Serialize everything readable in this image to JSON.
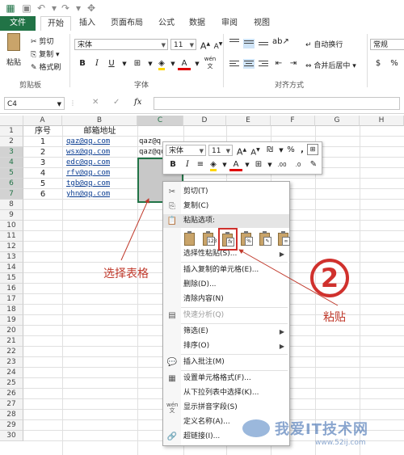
{
  "tabs": [
    "文件",
    "开始",
    "插入",
    "页面布局",
    "公式",
    "数据",
    "审阅",
    "视图"
  ],
  "clipboard": {
    "paste": "粘贴",
    "cut": "剪切",
    "copy": "复制",
    "format_painter": "格式刷",
    "label": "剪贴板"
  },
  "font": {
    "name": "宋体",
    "size": "11",
    "bold": "B",
    "italic": "I",
    "underline": "U",
    "grow": "A",
    "shrink": "A",
    "color_a": "A",
    "wen": "wén",
    "label": "字体"
  },
  "alignment": {
    "wrap": "自动换行",
    "merge": "合并后居中",
    "label": "对齐方式"
  },
  "number": {
    "format": "常规"
  },
  "formula_bar": {
    "cell_ref": "C4",
    "fx": "fx"
  },
  "columns": [
    "A",
    "B",
    "C",
    "D",
    "E",
    "F",
    "G",
    "H"
  ],
  "rows": [
    "1",
    "2",
    "3",
    "4",
    "5",
    "6",
    "7",
    "8",
    "9",
    "10",
    "11",
    "12",
    "13",
    "14",
    "15",
    "16",
    "17",
    "18",
    "19",
    "20",
    "21",
    "22",
    "23",
    "24",
    "25",
    "26",
    "27",
    "28",
    "29",
    "30"
  ],
  "table": {
    "header": [
      "序号",
      "邮箱地址"
    ],
    "rows": [
      [
        "1",
        "qaz@qq.com",
        "qaz@q"
      ],
      [
        "2",
        "wsx@qq.com",
        "qaz@qq"
      ],
      [
        "3",
        "edc@qq.com",
        ""
      ],
      [
        "4",
        "rfv@qq.com",
        ""
      ],
      [
        "5",
        "tgb@qq.com",
        ""
      ],
      [
        "6",
        "yhn@qq.com",
        ""
      ]
    ]
  },
  "mini_toolbar": {
    "font": "宋体",
    "size": "11",
    "grow": "A",
    "shrink": "A",
    "percent": "%",
    "comma": ",",
    "bold": "B",
    "italic": "I",
    "inc_dec": ".00",
    "dec_dec": ".0"
  },
  "context_menu": {
    "cut": "剪切(T)",
    "copy": "复制(C)",
    "paste_options": "粘贴选项:",
    "paste_special": "选择性粘贴(S)...",
    "insert_copied": "插入复制的单元格(E)...",
    "delete": "删除(D)...",
    "clear": "清除内容(N)",
    "quick_analysis": "快速分析(Q)",
    "filter": "筛选(E)",
    "sort": "排序(O)",
    "insert_comment": "插入批注(M)",
    "format_cells": "设置单元格格式(F)...",
    "pick_list": "从下拉列表中选择(K)...",
    "phonetic": "显示拼音字段(S)",
    "define_name": "定义名称(A)...",
    "hyperlink": "超链接(I)..."
  },
  "annotations": {
    "select_table": "选择表格",
    "step": "2",
    "paste": "粘贴"
  },
  "watermark": {
    "text": "我爱IT技术网",
    "url": "www.52ij.com"
  },
  "colors": {
    "excel_green": "#217346",
    "annotation_red": "#c0392b",
    "highlight_border": "#d0312d"
  }
}
